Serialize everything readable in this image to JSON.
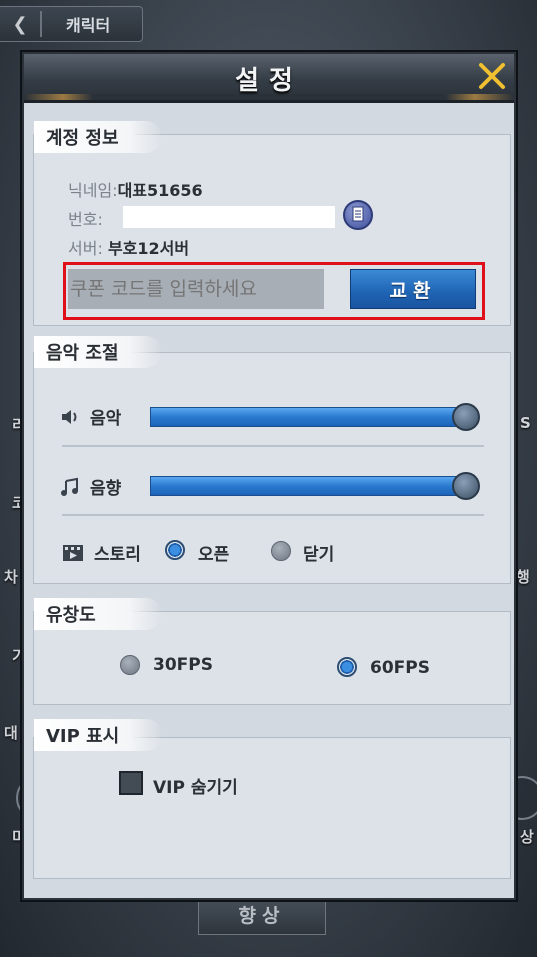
{
  "background": {
    "top_tab_label": "캐릭터",
    "bottom_button_label": "향상",
    "left_fragments": [
      "리",
      "코",
      "차",
      "기",
      "대",
      "미"
    ],
    "right_fragments": [
      "S",
      "행",
      "상"
    ]
  },
  "dialog": {
    "title": "설정"
  },
  "account": {
    "section_label": "계정 정보",
    "nickname_key": "닉네임:",
    "nickname_value": "대표51656",
    "number_key": "번호:",
    "server_key": "서버:",
    "server_value": "부호12서버",
    "coupon_placeholder": "쿠폰 코드를 입력하세요",
    "exchange_button": "교환"
  },
  "sound": {
    "section_label": "음악 조절",
    "music_label": "음악",
    "music_level": 1.0,
    "sfx_label": "음향",
    "sfx_level": 1.0,
    "story_label": "스토리",
    "story_options": [
      "오픈",
      "닫기"
    ],
    "story_selected": "오픈"
  },
  "fluency": {
    "section_label": "유창도",
    "options": [
      "30FPS",
      "60FPS"
    ],
    "selected": "60FPS"
  },
  "vip": {
    "section_label": "VIP 표시",
    "hide_label": "VIP 숨기기",
    "hide_checked": false
  },
  "colors": {
    "accent_blue": "#1f64b4",
    "highlight_red": "#e0101a",
    "panel_bg": "#d3d9e0"
  }
}
